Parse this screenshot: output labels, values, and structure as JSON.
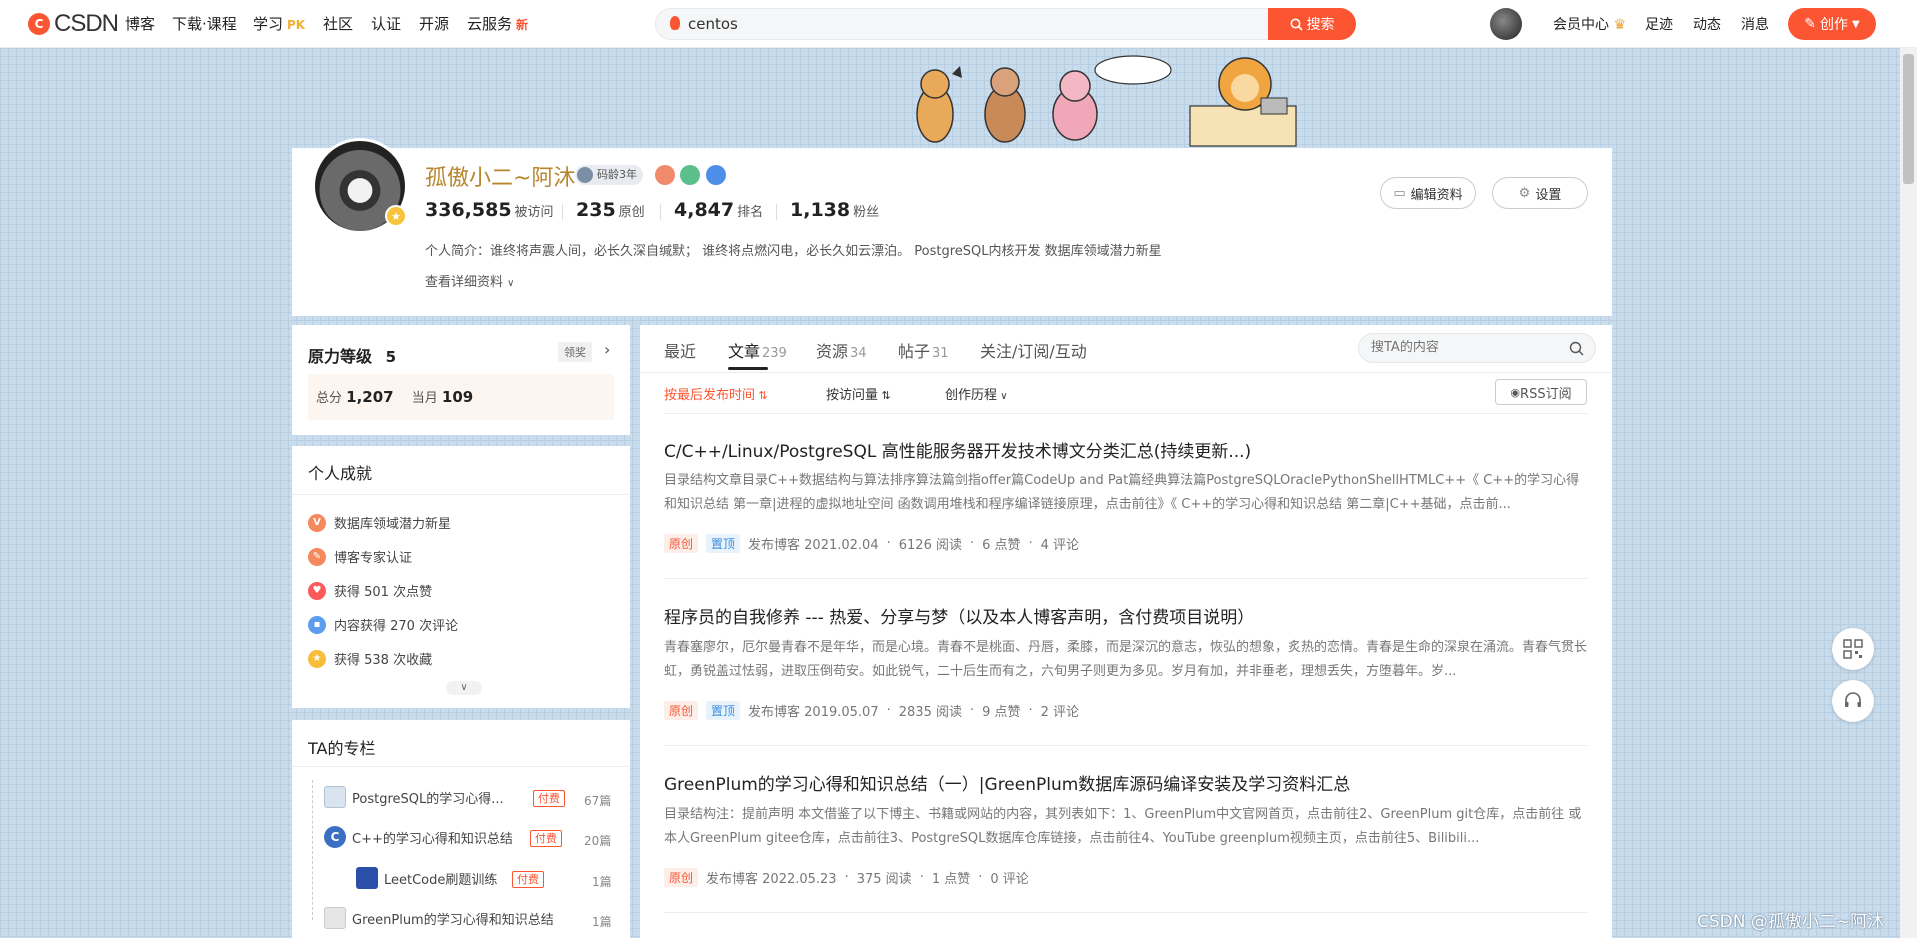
{
  "topnav": {
    "logo_text": "CSDN",
    "items": [
      {
        "label": "博客"
      },
      {
        "label": "下载·课程"
      },
      {
        "label": "学习",
        "tag": "PK"
      },
      {
        "label": "社区"
      },
      {
        "label": "认证"
      },
      {
        "label": "开源"
      },
      {
        "label": "云服务",
        "tag": "新"
      }
    ],
    "search_value": "centos",
    "search_button": "搜索",
    "right_items": [
      "会员中心",
      "足迹",
      "动态",
      "消息"
    ],
    "create_button": "创作"
  },
  "profile": {
    "name": "孤傲小二~阿沐",
    "code_age": "码龄3年",
    "stats": [
      {
        "value": "336,585",
        "label": "被访问"
      },
      {
        "value": "235",
        "label": "原创"
      },
      {
        "value": "4,847",
        "label": "排名"
      },
      {
        "value": "1,138",
        "label": "粉丝"
      }
    ],
    "bio": "个人简介：谁终将声震人间，必长久深自缄默；  谁终将点燃闪电，必长久如云漂泊。 PostgreSQL内核开发 数据库领域潜力新星",
    "detail_link": "查看详细资料",
    "edit_button": "编辑资料",
    "settings_button": "设置"
  },
  "level": {
    "title_a": "原力",
    "title_b": "等级",
    "level": "5",
    "claim": "领奖",
    "total_label": "总分",
    "total_value": "1,207",
    "month_label": "当月",
    "month_value": "109"
  },
  "achievements": {
    "title": "个人成就",
    "items": [
      {
        "text": "数据库领域潜力新星",
        "color": "#f4895d"
      },
      {
        "text": "博客专家认证",
        "color": "#f4895d"
      },
      {
        "text": "获得 501 次点赞",
        "color": "#fc5a5a"
      },
      {
        "text": "内容获得 270 次评论",
        "color": "#5c9ded"
      },
      {
        "text": "获得 538 次收藏",
        "color": "#f8be3b"
      }
    ]
  },
  "columns": {
    "title": "TA的专栏",
    "items": [
      {
        "name": "PostgreSQL的学习心得...",
        "paid": "付费",
        "count": "67篇"
      },
      {
        "name": "C++的学习心得和知识总结",
        "paid": "付费",
        "count": "20篇"
      },
      {
        "name": "LeetCode刷题训练",
        "paid": "付费",
        "count": "1篇"
      },
      {
        "name": "GreenPlum的学习心得和知识总结",
        "paid": "",
        "count": "1篇"
      }
    ]
  },
  "tabs": [
    {
      "label": "最近",
      "count": ""
    },
    {
      "label": "文章",
      "count": "239"
    },
    {
      "label": "资源",
      "count": "34"
    },
    {
      "label": "帖子",
      "count": "31"
    },
    {
      "label": "关注/订阅/互动",
      "count": ""
    }
  ],
  "main_search_placeholder": "搜TA的内容",
  "sort": {
    "by_time": "按最后发布时间",
    "by_visits": "按访问量",
    "history": "创作历程",
    "rss": "RSS订阅"
  },
  "articles": [
    {
      "title": "C/C++/Linux/PostgreSQL 高性能服务器开发技术博文分类汇总(持续更新...)",
      "desc": "目录结构文章目录C++数据结构与算法排序算法篇剑指offer篇CodeUp and Pat篇经典算法篇PostgreSQLOraclePythonShellHTMLC++《 C++的学习心得和知识总结 第一章|进程的虚拟地址空间 函数调用堆栈和程序编译链接原理，点击前往》《 C++的学习心得和知识总结 第二章|C++基础，点击前...",
      "original": "原创",
      "pinned": "置顶",
      "meta": [
        "发布博客 2021.02.04",
        "6126 阅读",
        "6 点赞",
        "4 评论"
      ]
    },
    {
      "title": "程序员的自我修养 --- 热爱、分享与梦（以及本人博客声明，含付费项目说明）",
      "desc": "青春塞廖尔，厄尔曼青春不是年华，而是心境。青春不是桃面、丹唇，柔膝，而是深沉的意志，恢弘的想象，炙热的恋情。青春是生命的深泉在涌流。青春气贯长虹，勇锐盖过怯弱，进取压倒苟安。如此锐气，二十后生而有之，六旬男子则更为多见。岁月有加，并非垂老，理想丢失，方堕暮年。岁...",
      "original": "原创",
      "pinned": "置顶",
      "meta": [
        "发布博客 2019.05.07",
        "2835 阅读",
        "9 点赞",
        "2 评论"
      ]
    },
    {
      "title": "GreenPlum的学习心得和知识总结（一）|GreenPlum数据库源码编译安装及学习资料汇总",
      "desc": "目录结构注：提前声明 本文借鉴了以下博主、书籍或网站的内容，其列表如下：1、GreenPlum中文官网首页，点击前往2、GreenPlum git仓库，点击前往 或 本人GreenPlum gitee仓库，点击前往3、PostgreSQL数据库仓库链接，点击前往4、YouTube greenplum视频主页，点击前往5、Bilibili...",
      "original": "原创",
      "pinned": "",
      "meta": [
        "发布博客 2022.05.23",
        "375 阅读",
        "1 点赞",
        "0 评论"
      ]
    }
  ],
  "watermark": "CSDN @孤傲小二~阿沐",
  "colors": {
    "brand": "#fc5531",
    "name": "#b7862d"
  }
}
